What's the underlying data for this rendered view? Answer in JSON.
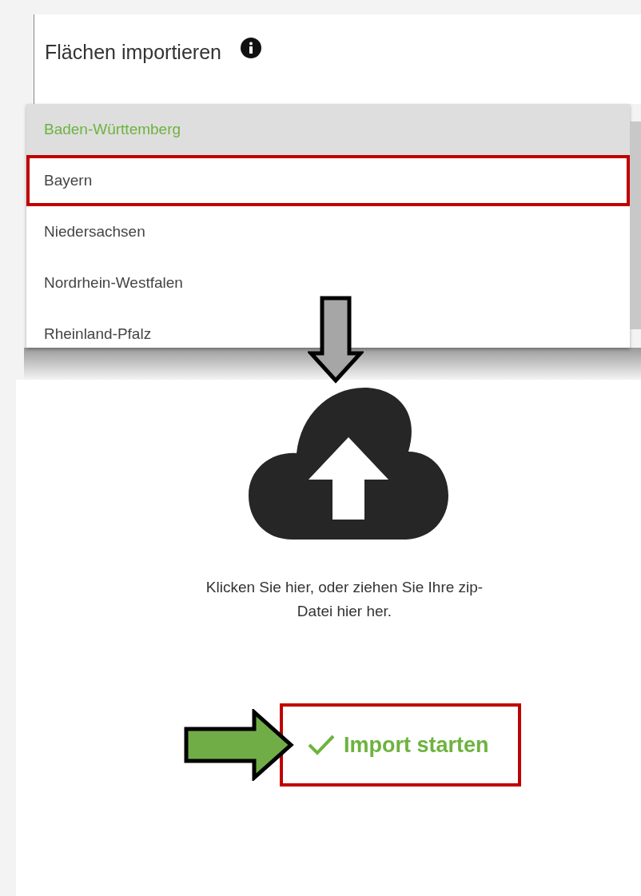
{
  "dialog": {
    "title": "Flächen importieren"
  },
  "dropdown": {
    "items": [
      {
        "label": "Baden-Württemberg",
        "selected": true,
        "marked": false
      },
      {
        "label": "Bayern",
        "selected": false,
        "marked": true
      },
      {
        "label": "Niedersachsen",
        "selected": false,
        "marked": false
      },
      {
        "label": "Nordrhein-Westfalen",
        "selected": false,
        "marked": false
      },
      {
        "label": "Rheinland-Pfalz",
        "selected": false,
        "marked": false
      }
    ]
  },
  "upload": {
    "hint": "Klicken Sie hier, oder ziehen Sie Ihre zip-Datei hier her."
  },
  "import_button": {
    "label": "Import starten",
    "marked": true
  }
}
